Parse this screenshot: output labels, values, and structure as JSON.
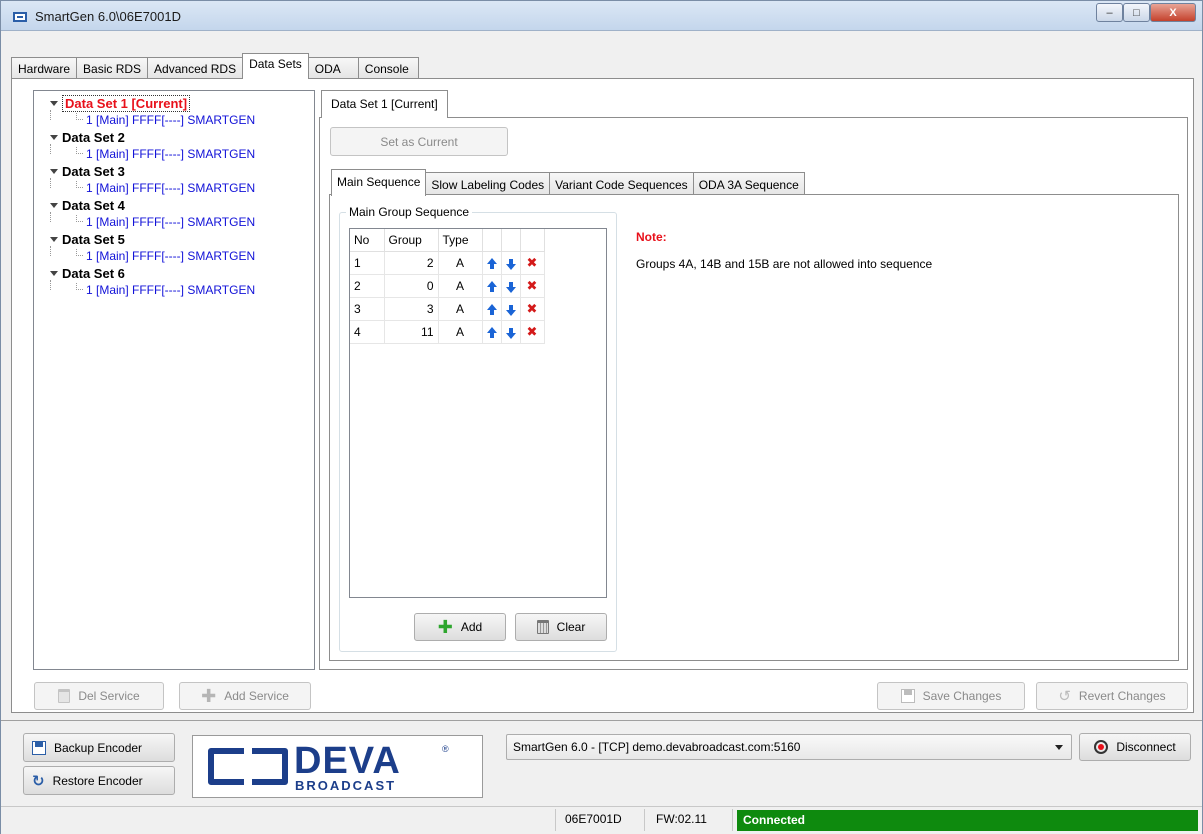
{
  "window": {
    "title": "SmartGen 6.0\\06E7001D",
    "buttons": [
      "–",
      "□",
      "X"
    ]
  },
  "tabs": [
    "Hardware",
    "Basic RDS",
    "Advanced RDS",
    "Data Sets",
    "ODA",
    "Console"
  ],
  "tree": [
    {
      "label": "Data Set 1 [Current]",
      "child": "1 [Main] FFFF[----] SMARTGEN"
    },
    {
      "label": "Data Set 2",
      "child": "1 [Main] FFFF[----] SMARTGEN"
    },
    {
      "label": "Data Set 3",
      "child": "1 [Main] FFFF[----] SMARTGEN"
    },
    {
      "label": "Data Set 4",
      "child": "1 [Main] FFFF[----] SMARTGEN"
    },
    {
      "label": "Data Set 5",
      "child": "1 [Main] FFFF[----] SMARTGEN"
    },
    {
      "label": "Data Set 6",
      "child": "1 [Main] FFFF[----] SMARTGEN"
    }
  ],
  "dataset_tab": "Data Set 1 [Current]",
  "set_current_label": "Set as Current",
  "seq_tabs": [
    "Main Sequence",
    "Slow Labeling Codes",
    "Variant Code Sequences",
    "ODA 3A Sequence"
  ],
  "group_box_title": "Main Group Sequence",
  "grid": {
    "headers": [
      "No",
      "Group",
      "Type"
    ],
    "rows": [
      {
        "no": "1",
        "group": "2",
        "type": "A"
      },
      {
        "no": "2",
        "group": "0",
        "type": "A"
      },
      {
        "no": "3",
        "group": "3",
        "type": "A"
      },
      {
        "no": "4",
        "group": "11",
        "type": "A"
      }
    ]
  },
  "add_label": "Add",
  "clear_label": "Clear",
  "note": {
    "title": "Note:",
    "text": "Groups 4A, 14B and 15B are not allowed into sequence"
  },
  "del_service_label": "Del Service",
  "add_service_label": "Add Service",
  "save_changes_label": "Save Changes",
  "revert_changes_label": "Revert Changes",
  "backup_label": "Backup Encoder",
  "restore_label": "Restore Encoder",
  "logo": {
    "main": "DEVA",
    "sub": "BROADCAST",
    "reg": "®"
  },
  "connection": "SmartGen 6.0 - [TCP] demo.devabroadcast.com:5160",
  "disconnect_label": "Disconnect",
  "status": {
    "device": "06E7001D",
    "fw": "FW:02.11",
    "state": "Connected",
    "state_color": "#0e8a0e"
  },
  "colors": {
    "current_red": "#e8101a",
    "link_blue": "#1212d8",
    "brand_blue": "#1c3e8a"
  }
}
